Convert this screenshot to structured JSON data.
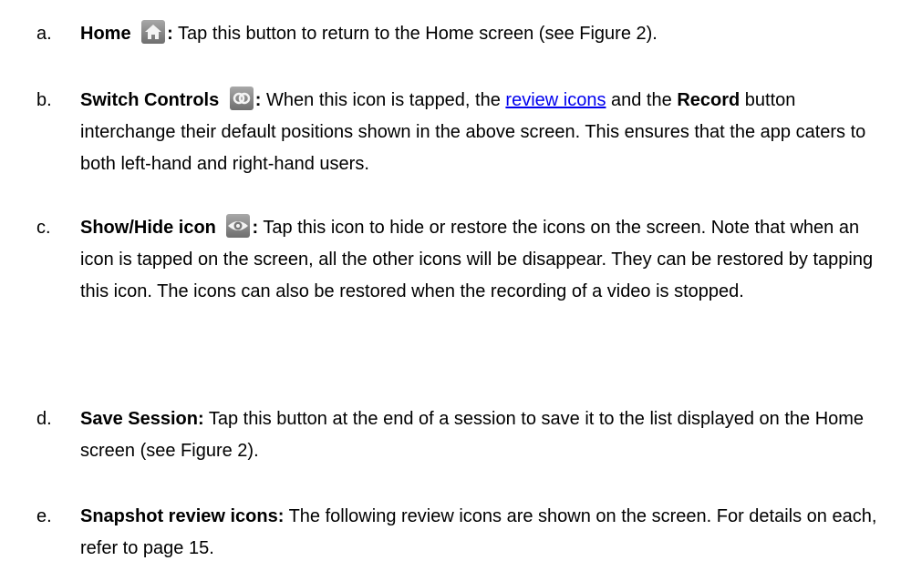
{
  "items": [
    {
      "marker": "a.",
      "term": "Home",
      "icon": "home-icon",
      "text": "Tap this button to return to the Home screen (see Figure 2)."
    },
    {
      "marker": "b.",
      "term": "Switch Controls",
      "icon": "switch-controls-icon",
      "text_before": "When this icon is tapped, the ",
      "link": "review icons",
      "text_mid": " and the",
      "term2": "Record",
      "text_after": " button interchange their default positions shown in the above screen. This ensures that the app caters to both left-hand and right-hand users."
    },
    {
      "marker": "c.",
      "term": "Show/Hide icon",
      "icon": "eye-icon",
      "text": "Tap this icon to hide or restore the icons on the screen. Note that when an icon is tapped on the screen, all the other icons will be disappear. They can be restored by tapping this icon. The icons can also be restored when the recording of a video is stopped."
    },
    {
      "marker": "d.",
      "term": "Save Session:",
      "text": "Tap this button at the end of a session to save it to the list displayed on the Home screen (see Figure 2)."
    },
    {
      "marker": "e.",
      "term": "Snapshot review icons:",
      "text": "The following review icons are shown on the screen. For details on each, refer to page 15."
    }
  ],
  "colon": ":",
  "colors": {
    "link": "#0000ee",
    "icon_bg": "#8c8c8c",
    "icon_accent": "#ffffff"
  }
}
